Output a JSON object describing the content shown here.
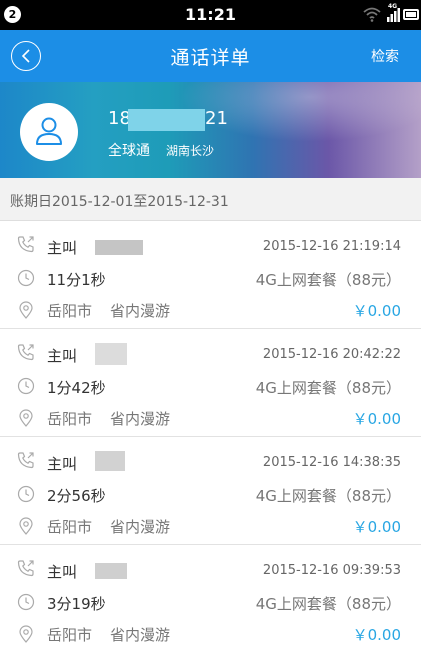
{
  "status_bar": {
    "notification_count": "2",
    "time": "11:21",
    "network_label": "4G"
  },
  "header": {
    "title": "通话详单",
    "search_label": "检索"
  },
  "profile": {
    "phone_prefix": "18",
    "phone_suffix": "21",
    "plan_name": "全球通",
    "location": "湖南长沙"
  },
  "billing_period": "账期日2015-12-01至2015-12-31",
  "colors": {
    "header_bg": "#1c8ee6",
    "fee_text": "#28a6e3",
    "status_bar_bg": "#000000"
  },
  "records": [
    {
      "call_type": "主叫",
      "datetime": "2015-12-16 21:19:14",
      "duration": "11分1秒",
      "package": "4G上网套餐（88元）",
      "city": "岳阳市",
      "roaming": "省内漫游",
      "fee": "￥0.00"
    },
    {
      "call_type": "主叫",
      "datetime": "2015-12-16 20:42:22",
      "duration": "1分42秒",
      "package": "4G上网套餐（88元）",
      "city": "岳阳市",
      "roaming": "省内漫游",
      "fee": "￥0.00"
    },
    {
      "call_type": "主叫",
      "datetime": "2015-12-16 14:38:35",
      "duration": "2分56秒",
      "package": "4G上网套餐（88元）",
      "city": "岳阳市",
      "roaming": "省内漫游",
      "fee": "￥0.00"
    },
    {
      "call_type": "主叫",
      "datetime": "2015-12-16 09:39:53",
      "duration": "3分19秒",
      "package": "4G上网套餐（88元）",
      "city": "岳阳市",
      "roaming": "省内漫游",
      "fee": "￥0.00"
    }
  ]
}
